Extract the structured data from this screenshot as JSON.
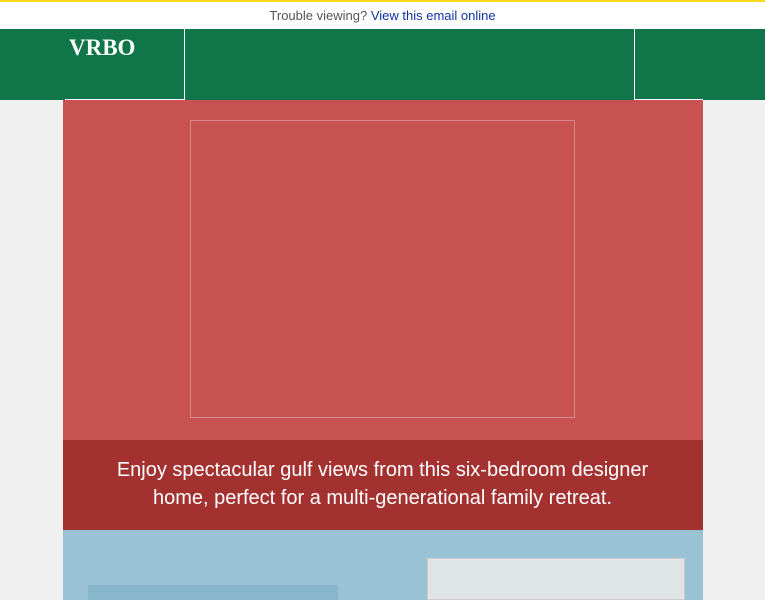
{
  "preheader": {
    "text": "Trouble viewing? ",
    "link_text": "View this email online"
  },
  "header": {
    "logo": "VRBO"
  },
  "hero": {
    "caption": "Enjoy spectacular gulf views from this six-bedroom designer home, perfect for a multi-generational family retreat."
  },
  "colors": {
    "brand_green": "#107649",
    "hero_red": "#c75251",
    "caption_dark_red": "#a33130",
    "section_blue": "#99c3d5"
  }
}
